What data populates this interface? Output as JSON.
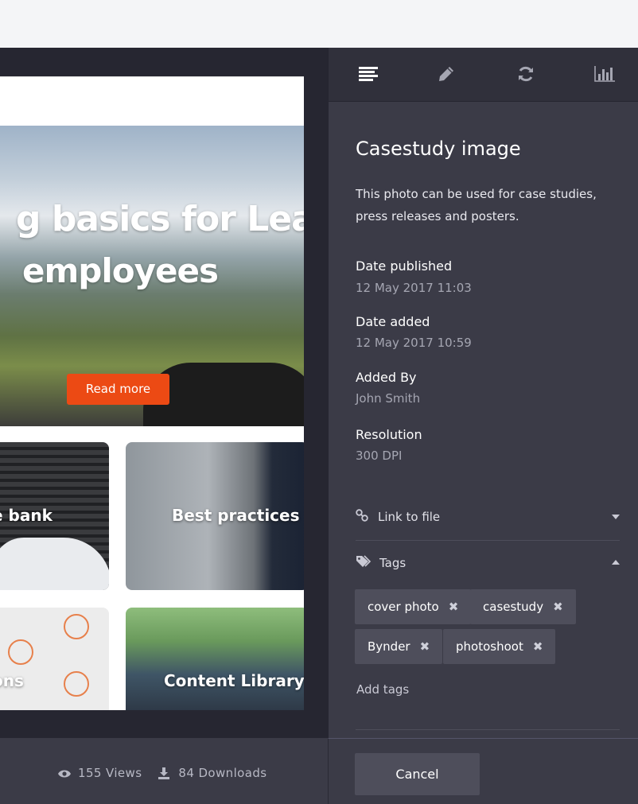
{
  "preview": {
    "hero_line1": "g basics for Lease",
    "hero_line2": "employees",
    "read_more": "Read more",
    "tiles": [
      "e bank",
      "Best practices",
      "ons",
      "Content Library"
    ]
  },
  "stats": {
    "views": "155 Views",
    "downloads": "84 Downloads"
  },
  "panel": {
    "tabs": [
      "details-icon",
      "edit-icon",
      "refresh-icon",
      "stats-icon"
    ],
    "title": "Casestudy image",
    "description": "This photo can be used for case studies, press releases and posters.",
    "meta": [
      {
        "label": "Date published",
        "value": "12 May  2017 11:03"
      },
      {
        "label": "Date added",
        "value": "12 May  2017 10:59"
      },
      {
        "label": "Added By",
        "value": "John Smith"
      },
      {
        "label": "Resolution",
        "value": "300 DPI"
      }
    ],
    "link_to_file": "Link to file",
    "tags_label": "Tags",
    "tags": [
      "cover photo",
      "casestudy",
      "Bynder",
      "photoshoot"
    ],
    "add_tags": "Add tags",
    "cancel": "Cancel"
  },
  "colors": {
    "accent": "#ec4a14",
    "panel_bg": "#3b3b47",
    "tag_bg": "#4e4e5b"
  }
}
